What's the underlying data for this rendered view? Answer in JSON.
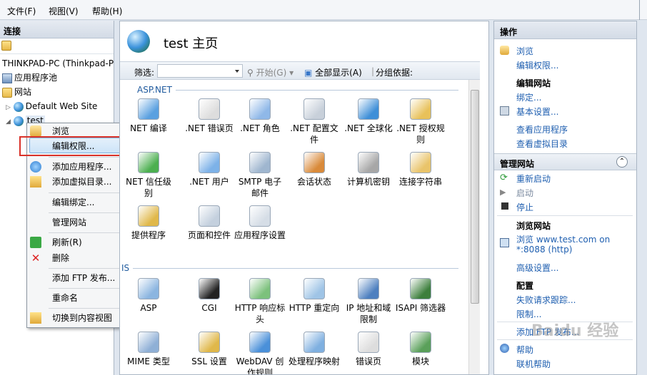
{
  "menu": {
    "file": "文件(F)",
    "view": "视图(V)",
    "help": "帮助(H)"
  },
  "left": {
    "header": "连接",
    "tree": {
      "server": "THINKPAD-PC (Thinkpad-P",
      "app_pools": "应用程序池",
      "sites": "网站",
      "default_site": "Default Web Site",
      "test_site": "test"
    }
  },
  "context_menu": {
    "browse": "浏览",
    "edit_permissions": "编辑权限...",
    "add_application": "添加应用程序...",
    "add_virtual_dir": "添加虚拟目录...",
    "edit_bindings": "编辑绑定...",
    "manage_site": "管理网站",
    "refresh": "刷新(R)",
    "delete": "删除",
    "add_ftp": "添加 FTP 发布...",
    "rename": "重命名",
    "switch_content_view": "切换到内容视图"
  },
  "center": {
    "title": "test 主页",
    "filter_label": "筛选:",
    "start_label": "开始(G)",
    "show_all_label": "全部显示(A)",
    "group_by_label": "分组依据:",
    "section_aspnet": "ASP.NET",
    "section_iis": "IS",
    "aspnet_features": [
      {
        "label": "NET 编译",
        "color": "#5aa0e0",
        "icon": "compile-icon"
      },
      {
        "label": ".NET 错误页",
        "color": "#ddd",
        "icon": "error-page-icon"
      },
      {
        "label": ".NET 角色",
        "color": "#8fb8e8",
        "icon": "roles-icon"
      },
      {
        "label": ".NET 配置文件",
        "color": "#c8d0da",
        "icon": "profile-icon"
      },
      {
        "label": ".NET 全球化",
        "color": "#3f8fd8",
        "icon": "globalization-icon"
      },
      {
        "label": ".NET 授权规则",
        "color": "#e8c15a",
        "icon": "authorization-icon"
      },
      {
        "label": "NET 信任级别",
        "color": "#4caf50",
        "icon": "trust-icon"
      },
      {
        "label": ".NET 用户",
        "color": "#7db2e8",
        "icon": "users-icon"
      },
      {
        "label": "SMTP 电子邮件",
        "color": "#9fb6cf",
        "icon": "smtp-icon"
      },
      {
        "label": "会话状态",
        "color": "#d98a3a",
        "icon": "session-icon"
      },
      {
        "label": "计算机密钥",
        "color": "#a7a7a7",
        "icon": "machine-key-icon"
      },
      {
        "label": "连接字符串",
        "color": "#e9c46a",
        "icon": "connection-string-icon"
      },
      {
        "label": "提供程序",
        "color": "#e0b84a",
        "icon": "providers-icon"
      },
      {
        "label": "页面和控件",
        "color": "#c4d0de",
        "icon": "pages-controls-icon"
      },
      {
        "label": "应用程序设置",
        "color": "#d5dde6",
        "icon": "app-settings-icon"
      }
    ],
    "iis_features": [
      {
        "label": "ASP",
        "color": "#8bb5e0",
        "icon": "asp-icon"
      },
      {
        "label": "CGI",
        "color": "#222",
        "icon": "cgi-icon"
      },
      {
        "label": "HTTP 响应标头",
        "color": "#7cc17c",
        "icon": "http-headers-icon"
      },
      {
        "label": "HTTP 重定向",
        "color": "#9fc4e6",
        "icon": "redirect-icon"
      },
      {
        "label": "IP 地址和域限制",
        "color": "#4d7fbf",
        "icon": "ip-restriction-icon"
      },
      {
        "label": "ISAPI 筛选器",
        "color": "#3d7f3d",
        "icon": "isapi-icon"
      },
      {
        "label": "MIME 类型",
        "color": "#8fb0d6",
        "icon": "mime-icon"
      },
      {
        "label": "SSL 设置",
        "color": "#e0b84a",
        "icon": "ssl-icon"
      },
      {
        "label": "WebDAV 创作规则",
        "color": "#4a90d9",
        "icon": "webdav-icon"
      },
      {
        "label": "处理程序映射",
        "color": "#7fb0e0",
        "icon": "handler-icon"
      },
      {
        "label": "错误页",
        "color": "#ddd",
        "icon": "error-pages-icon"
      },
      {
        "label": "模块",
        "color": "#5aa05a",
        "icon": "modules-icon"
      }
    ]
  },
  "right": {
    "header": "操作",
    "browse": "浏览",
    "edit_permissions": "编辑权限...",
    "edit_site": "编辑网站",
    "bindings": "绑定...",
    "basic_settings": "基本设置...",
    "view_apps": "查看应用程序",
    "view_vdirs": "查看虚拟目录",
    "manage_site": "管理网站",
    "collapse": "⌃",
    "restart": "重新启动",
    "start": "启动",
    "stop": "停止",
    "browse_site": "浏览网站",
    "browse_url": "浏览 www.test.com on",
    "browse_port": "*:8088 (http)",
    "advanced_settings": "高级设置...",
    "configure": "配置",
    "failed_request": "失败请求跟踪...",
    "limits": "限制...",
    "add_ftp_publish": "添加 FTP 发布...",
    "help": "帮助",
    "online_help": "联机帮助"
  },
  "watermark": "Baidu 经验",
  "colors": {
    "link": "#1f5fb0",
    "highlight": "#cde4f8",
    "red_box": "#d9322a"
  }
}
